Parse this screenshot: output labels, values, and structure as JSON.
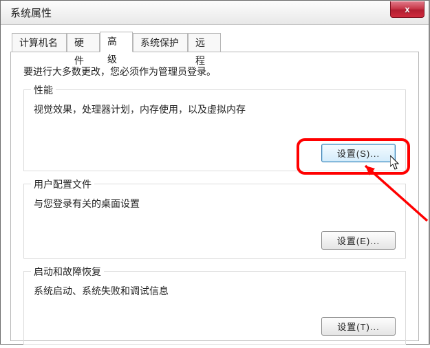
{
  "window": {
    "title": "系统属性",
    "close_label": "x"
  },
  "tabs": {
    "computer_name": "计算机名",
    "hardware": "硬件",
    "advanced": "高级",
    "system_protection": "系统保护",
    "remote": "远程"
  },
  "advanced": {
    "instruction": "要进行大多数更改，您必须作为管理员登录。",
    "groups": {
      "performance": {
        "title": "性能",
        "desc": "视觉效果，处理器计划，内存使用，以及虚拟内存",
        "button": "设置(S)..."
      },
      "user_profiles": {
        "title": "用户配置文件",
        "desc": "与您登录有关的桌面设置",
        "button": "设置(E)..."
      },
      "startup_recovery": {
        "title": "启动和故障恢复",
        "desc": "系统启动、系统失败和调试信息",
        "button": "设置(T)..."
      }
    }
  },
  "annotation": {
    "color": "#ff0000"
  }
}
